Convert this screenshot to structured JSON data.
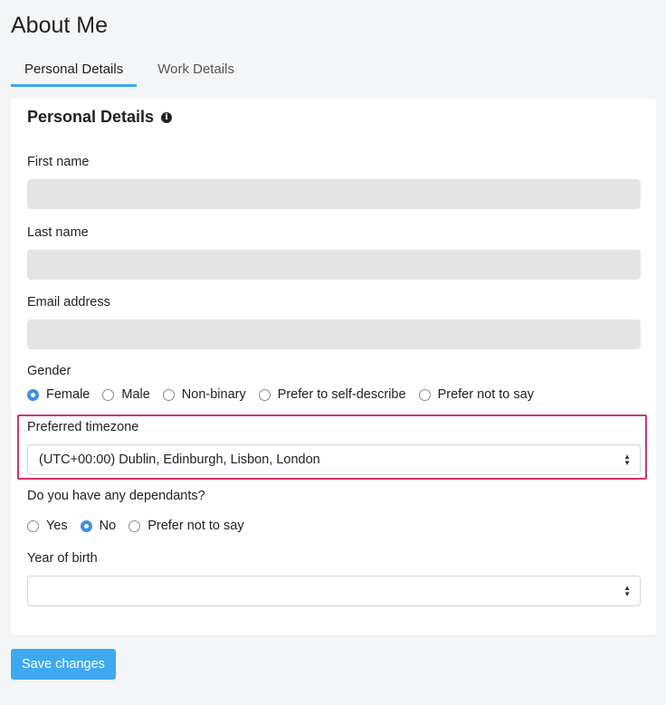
{
  "page": {
    "title": "About Me"
  },
  "tabs": [
    {
      "label": "Personal Details"
    },
    {
      "label": "Work Details"
    }
  ],
  "card": {
    "title": "Personal Details",
    "info_icon": "info-icon"
  },
  "fields": {
    "first_name": {
      "label": "First name",
      "value": ""
    },
    "last_name": {
      "label": "Last name",
      "value": ""
    },
    "email": {
      "label": "Email address",
      "value": ""
    },
    "gender": {
      "label": "Gender",
      "options": [
        "Female",
        "Male",
        "Non-binary",
        "Prefer to self-describe",
        "Prefer not to say"
      ],
      "selected": "Female"
    },
    "timezone": {
      "label": "Preferred timezone",
      "value": "(UTC+00:00) Dublin, Edinburgh, Lisbon, London"
    },
    "dependants": {
      "label": "Do you have any dependants?",
      "options": [
        "Yes",
        "No",
        "Prefer not to say"
      ],
      "selected": "No"
    },
    "year_of_birth": {
      "label": "Year of birth",
      "value": ""
    }
  },
  "actions": {
    "save_label": "Save changes"
  },
  "colors": {
    "accent": "#3da9f0",
    "highlight": "#d6336c"
  }
}
